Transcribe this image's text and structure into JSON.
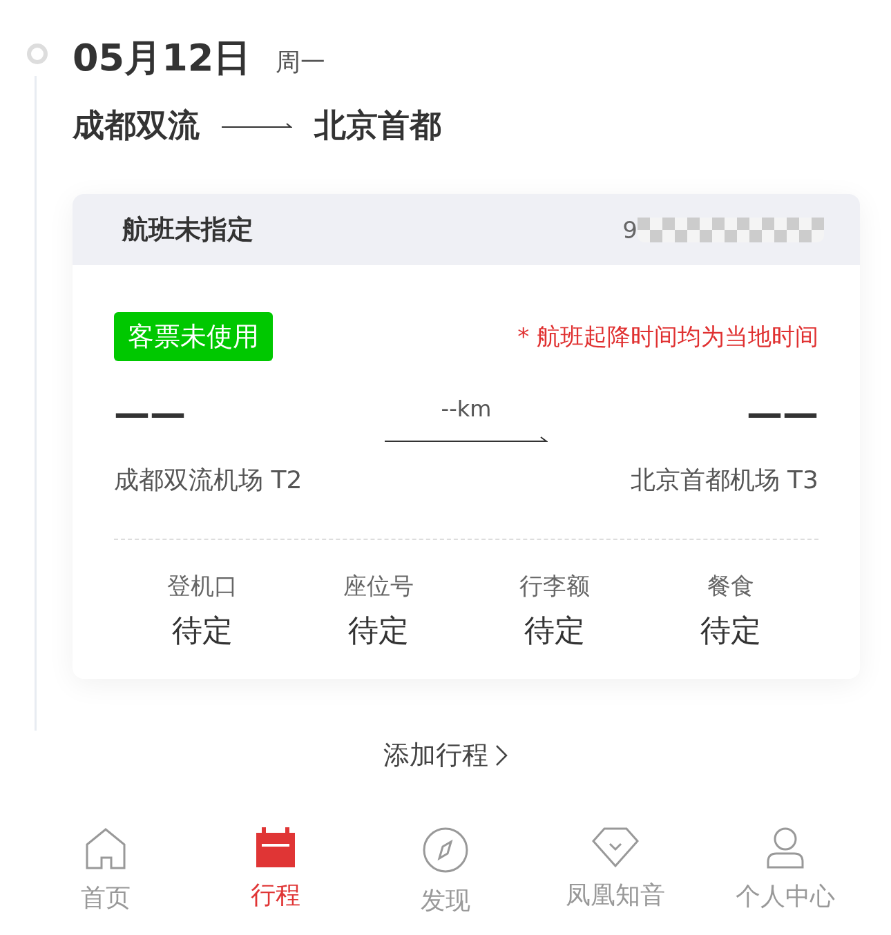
{
  "date": {
    "day": "05月12日",
    "weekday": "周一"
  },
  "route": {
    "from": "成都双流",
    "to": "北京首都"
  },
  "card": {
    "title": "航班未指定",
    "flight_number": "9",
    "status_badge": "客票未使用",
    "note": "* 航班起降时间均为当地时间",
    "departure": {
      "time": "——",
      "airport": "成都双流机场 T2"
    },
    "distance": "--km",
    "arrival": {
      "time": "——",
      "airport": "北京首都机场 T3"
    },
    "details": [
      {
        "label": "登机口",
        "value": "待定"
      },
      {
        "label": "座位号",
        "value": "待定"
      },
      {
        "label": "行李额",
        "value": "待定"
      },
      {
        "label": "餐食",
        "value": "待定"
      }
    ]
  },
  "add_trip": "添加行程",
  "tabs": [
    {
      "label": "首页",
      "kind": "home",
      "selected": false
    },
    {
      "label": "行程",
      "kind": "trips",
      "selected": true
    },
    {
      "label": "发现",
      "kind": "discover",
      "selected": false
    },
    {
      "label": "凤凰知音",
      "kind": "membership",
      "selected": false
    },
    {
      "label": "个人中心",
      "kind": "profile",
      "selected": false
    }
  ]
}
